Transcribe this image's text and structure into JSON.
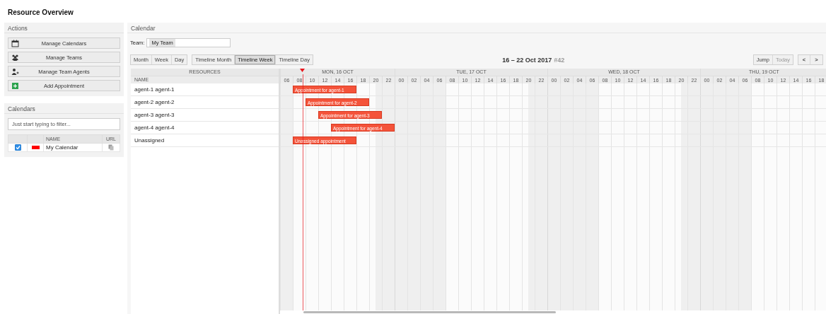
{
  "page_title": "Resource Overview",
  "actions": {
    "title": "Actions",
    "buttons": [
      {
        "label": "Manage Calendars"
      },
      {
        "label": "Manage Teams"
      },
      {
        "label": "Manage Team Agents"
      },
      {
        "label": "Add Appointment"
      }
    ]
  },
  "calendars": {
    "title": "Calendars",
    "filter": {
      "placeholder": "Just start typing to filter..."
    },
    "columns": [
      "NAME",
      "URL"
    ],
    "rows": [
      {
        "checked": true,
        "color": "#ff0000",
        "name": "My Calendar"
      }
    ]
  },
  "calendar": {
    "title": "Calendar",
    "team": {
      "label": "Team:",
      "value": "My Team"
    },
    "views": [
      [
        {
          "label": "Month",
          "selected": false
        },
        {
          "label": "Week",
          "selected": false
        },
        {
          "label": "Day",
          "selected": false
        }
      ],
      [
        {
          "label": "Timeline Month",
          "selected": false
        },
        {
          "label": "Timeline Week",
          "selected": true
        },
        {
          "label": "Timeline Day",
          "selected": false
        }
      ]
    ],
    "range": "16 – 22 Oct 2017",
    "week": "#42",
    "nav": [
      {
        "label": "Jump",
        "disabled": false
      },
      {
        "label": "Today",
        "disabled": true
      }
    ],
    "arrows": [
      "<",
      ">"
    ],
    "resources_header": "RESOURCES",
    "name_header": "NAME",
    "days": [
      {
        "label": "MON, 16 OCT",
        "hours": [
          "06",
          "08",
          "10",
          "12",
          "14",
          "16",
          "18",
          "20",
          "22"
        ]
      },
      {
        "label": "TUE, 17 OCT",
        "hours": [
          "00",
          "02",
          "04",
          "06",
          "08",
          "10",
          "12",
          "14",
          "16",
          "18",
          "20",
          "22"
        ]
      },
      {
        "label": "WED, 18 OCT",
        "hours": [
          "00",
          "02",
          "04",
          "06",
          "08",
          "10",
          "12",
          "14",
          "16",
          "18",
          "20",
          "22"
        ]
      },
      {
        "label": "THU, 19 OCT",
        "hours": [
          "00",
          "02",
          "04",
          "06",
          "08",
          "10",
          "12",
          "14",
          "16",
          "18"
        ]
      }
    ],
    "resources": [
      {
        "name": "agent-1 agent-1",
        "appointments": [
          {
            "title": "Appointment for agent-1"
          }
        ]
      },
      {
        "name": "agent-2 agent-2",
        "appointments": [
          {
            "title": "Appointment for agent-2"
          }
        ]
      },
      {
        "name": "agent-3 agent-3",
        "appointments": [
          {
            "title": "Appointment for agent-3"
          }
        ]
      },
      {
        "name": "agent-4 agent-4",
        "appointments": [
          {
            "title": "Appointment for agent-4"
          }
        ]
      },
      {
        "name": "Unassigned",
        "appointments": [
          {
            "title": "Unassigned appointment"
          }
        ]
      }
    ]
  }
}
